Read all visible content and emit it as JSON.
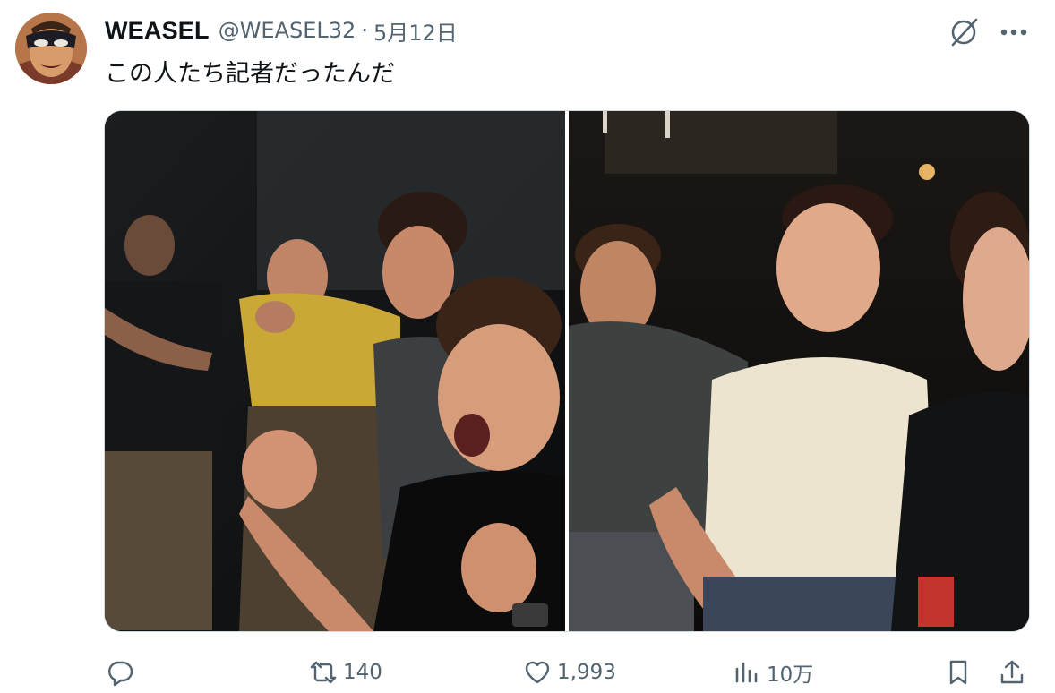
{
  "tweet": {
    "display_name": "WEASEL",
    "handle": "@WEASEL32",
    "separator": "·",
    "date": "5月12日",
    "text": "この人たち記者だったんだ"
  },
  "actions": {
    "reply": {
      "icon": "reply-icon",
      "count": ""
    },
    "retweet": {
      "icon": "retweet-icon",
      "count": "140"
    },
    "like": {
      "icon": "heart-icon",
      "count": "1,993"
    },
    "views": {
      "icon": "views-icon",
      "count": "10万"
    },
    "bookmark": {
      "icon": "bookmark-icon"
    },
    "share": {
      "icon": "share-icon"
    }
  },
  "colors": {
    "text_primary": "#0f1419",
    "text_secondary": "#536471",
    "border": "#cfd9de"
  }
}
